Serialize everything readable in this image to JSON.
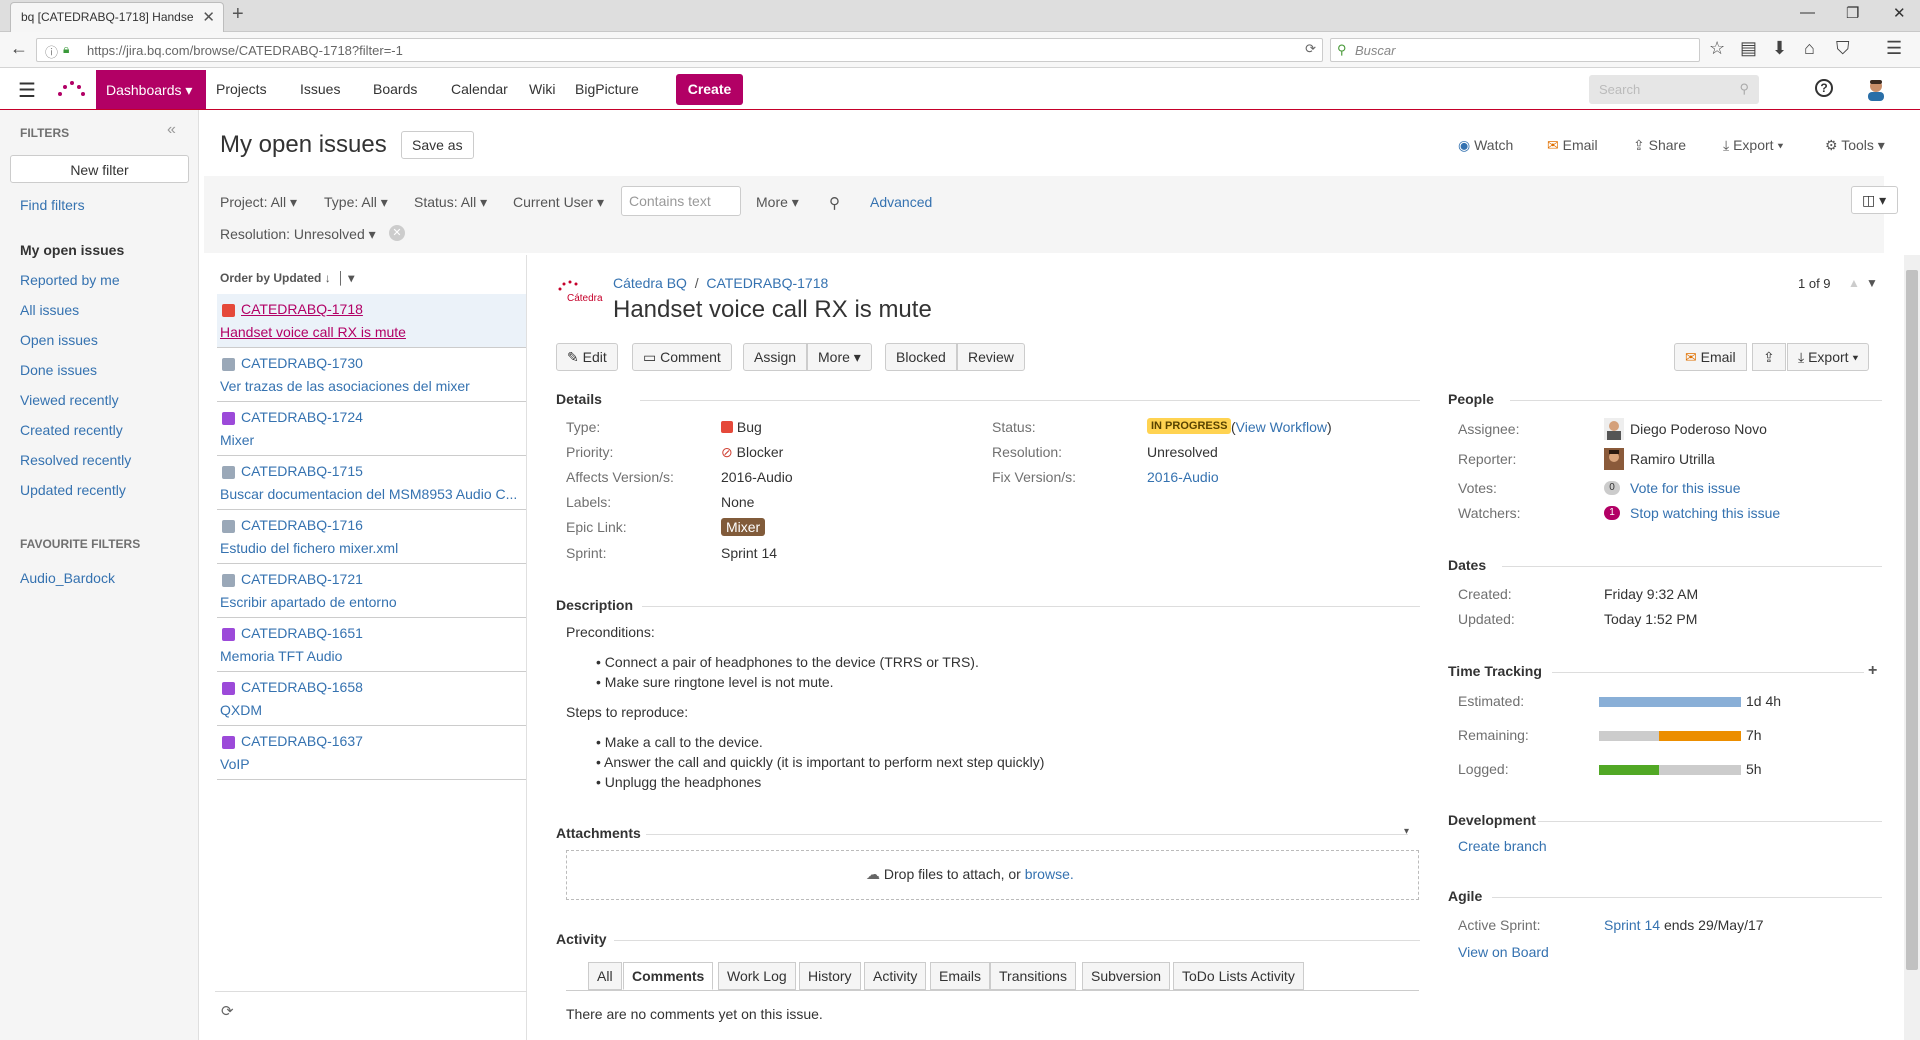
{
  "browser": {
    "tab_title": "bq  [CATEDRABQ-1718] Handse",
    "url": "https://jira.bq.com/browse/CATEDRABQ-1718?filter=-1",
    "search_placeholder": "Buscar"
  },
  "nav": {
    "items": [
      "Dashboards",
      "Projects",
      "Issues",
      "Boards",
      "Calendar",
      "Wiki",
      "BigPicture"
    ],
    "create": "Create",
    "search_placeholder": "Search"
  },
  "sidebar": {
    "heading": "FILTERS",
    "new_filter": "New filter",
    "find_filters": "Find filters",
    "links": [
      "My open issues",
      "Reported by me",
      "All issues",
      "Open issues",
      "Done issues",
      "Viewed recently",
      "Created recently",
      "Resolved recently",
      "Updated recently"
    ],
    "fav_heading": "FAVOURITE FILTERS",
    "fav_items": [
      "Audio_Bardock"
    ]
  },
  "page": {
    "title": "My open issues",
    "save_as": "Save as",
    "tools": [
      "Watch",
      "Email",
      "Share",
      "Export",
      "Tools"
    ]
  },
  "filters": {
    "project": "Project: All",
    "type": "Type: All",
    "status": "Status: All",
    "user": "Current User",
    "text_placeholder": "Contains text",
    "more": "More",
    "advanced": "Advanced",
    "resolution": "Resolution: Unresolved"
  },
  "list": {
    "order": "Order by Updated",
    "items": [
      {
        "key": "CATEDRABQ-1718",
        "title": "Handset voice call RX is mute",
        "type": "bug"
      },
      {
        "key": "CATEDRABQ-1730",
        "title": "Ver trazas de las asociaciones del mixer",
        "type": "task"
      },
      {
        "key": "CATEDRABQ-1724",
        "title": "Mixer",
        "type": "story"
      },
      {
        "key": "CATEDRABQ-1715",
        "title": "Buscar documentacion del MSM8953 Audio C...",
        "type": "task"
      },
      {
        "key": "CATEDRABQ-1716",
        "title": "Estudio del fichero mixer.xml",
        "type": "task"
      },
      {
        "key": "CATEDRABQ-1721",
        "title": "Escribir apartado de entorno",
        "type": "task"
      },
      {
        "key": "CATEDRABQ-1651",
        "title": "Memoria TFT Audio",
        "type": "story"
      },
      {
        "key": "CATEDRABQ-1658",
        "title": "QXDM",
        "type": "story"
      },
      {
        "key": "CATEDRABQ-1637",
        "title": "VoIP",
        "type": "story"
      }
    ]
  },
  "issue": {
    "project": "Cátedra BQ",
    "logo_text": "Cátedra",
    "key": "CATEDRABQ-1718",
    "summary": "Handset voice call RX is mute",
    "counter": "1 of 9",
    "actions": {
      "edit": "Edit",
      "comment": "Comment",
      "assign": "Assign",
      "more": "More",
      "blocked": "Blocked",
      "review": "Review",
      "email": "Email",
      "export": "Export"
    },
    "details_heading": "Details",
    "labels": {
      "type": "Type:",
      "priority": "Priority:",
      "affects": "Affects Version/s:",
      "labels": "Labels:",
      "epic": "Epic Link:",
      "sprint": "Sprint:",
      "status": "Status:",
      "resolution": "Resolution:",
      "fix": "Fix Version/s:"
    },
    "values": {
      "type": "Bug",
      "priority": "Blocker",
      "affects": "2016-Audio",
      "labels": "None",
      "epic": "Mixer",
      "sprint": "Sprint 14",
      "status": "IN PROGRESS",
      "workflow": "View Workflow",
      "resolution": "Unresolved",
      "fix": "2016-Audio"
    },
    "description": {
      "heading": "Description",
      "pre": "Preconditions:",
      "pre_items": [
        "Connect a pair of headphones to the device (TRRS or TRS).",
        "Make sure ringtone level is not mute."
      ],
      "steps": "Steps to reproduce:",
      "step_items": [
        "Make a call to the device.",
        "Answer the call and quickly (it is important to perform next step quickly)",
        "Unplugg the headphones"
      ]
    },
    "attachments": {
      "heading": "Attachments",
      "drop": "Drop files to attach, or",
      "browse": "browse."
    },
    "activity": {
      "heading": "Activity",
      "tabs": [
        "All",
        "Comments",
        "Work Log",
        "History",
        "Activity",
        "Emails",
        "Transitions",
        "Subversion",
        "ToDo Lists Activity"
      ],
      "active_tab": "Comments",
      "empty": "There are no comments yet on this issue."
    },
    "people": {
      "heading": "People",
      "assignee_l": "Assignee:",
      "assignee": "Diego Poderoso Novo",
      "reporter_l": "Reporter:",
      "reporter": "Ramiro Utrilla",
      "votes_l": "Votes:",
      "votes_count": "0",
      "votes": "Vote for this issue",
      "watchers_l": "Watchers:",
      "watchers_count": "1",
      "watchers": "Stop watching this issue"
    },
    "dates": {
      "heading": "Dates",
      "created_l": "Created:",
      "created": "Friday 9:32 AM",
      "updated_l": "Updated:",
      "updated": "Today 1:52 PM"
    },
    "time": {
      "heading": "Time Tracking",
      "estimated_l": "Estimated:",
      "estimated": "1d 4h",
      "remaining_l": "Remaining:",
      "remaining": "7h",
      "logged_l": "Logged:",
      "logged": "5h",
      "remaining_fraction": 0.58,
      "logged_fraction": 0.42
    },
    "development": {
      "heading": "Development",
      "create_branch": "Create branch"
    },
    "agile": {
      "heading": "Agile",
      "sprint_l": "Active Sprint:",
      "sprint": "Sprint 14",
      "ends": "ends 29/May/17",
      "view_board": "View on Board"
    }
  },
  "colors": {
    "brand": "#b20065",
    "link": "#3572b0",
    "estimated": "#89afd7",
    "remaining": "#ec8e00",
    "logged": "#51a825"
  }
}
